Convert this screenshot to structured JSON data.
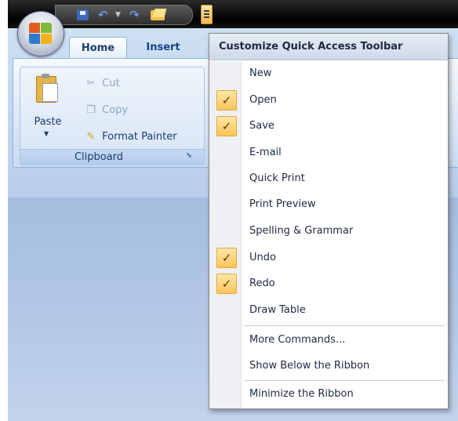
{
  "qat": {
    "icons": [
      "save-icon",
      "undo-icon",
      "dropdown-arrow-icon",
      "redo-icon",
      "open-folder-icon",
      "customize-icon"
    ]
  },
  "tabs": {
    "home": "Home",
    "insert": "Insert"
  },
  "clipboard": {
    "paste": "Paste",
    "cut": "Cut",
    "copy": "Copy",
    "format_painter": "Format Painter",
    "group_label": "Clipboard"
  },
  "menu": {
    "title": "Customize Quick Access Toolbar",
    "items": [
      {
        "label": "New",
        "checked": false
      },
      {
        "label": "Open",
        "checked": true
      },
      {
        "label": "Save",
        "checked": true
      },
      {
        "label": "E-mail",
        "checked": false
      },
      {
        "label": "Quick Print",
        "checked": false
      },
      {
        "label": "Print Preview",
        "checked": false
      },
      {
        "label": "Spelling & Grammar",
        "checked": false
      },
      {
        "label": "Undo",
        "checked": true
      },
      {
        "label": "Redo",
        "checked": true
      },
      {
        "label": "Draw Table",
        "checked": false
      },
      {
        "label": "More Commands...",
        "checked": false
      },
      {
        "label": "Show Below the Ribbon",
        "checked": false
      },
      {
        "label": "Minimize the Ribbon",
        "checked": false
      }
    ],
    "check_glyph": "✓"
  },
  "colors": {
    "check_highlight": "#fbc458",
    "ribbon_blue": "#c9dbf2",
    "titlebar": "#000000"
  }
}
